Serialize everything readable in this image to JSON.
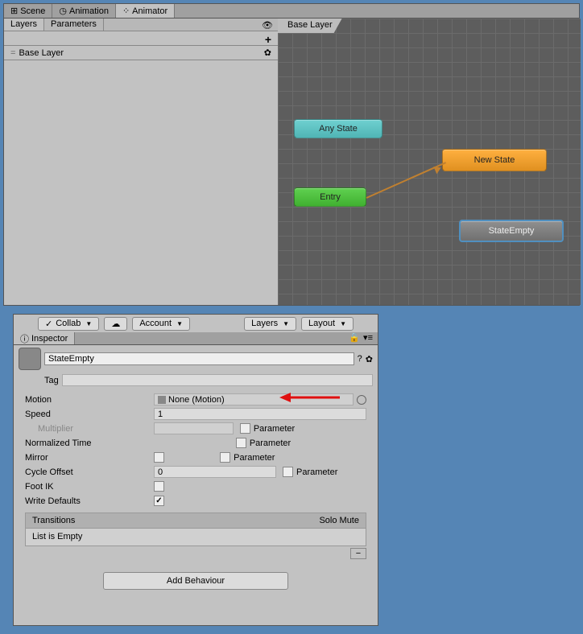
{
  "top": {
    "tabs": [
      {
        "label": "Scene",
        "icon": "grid-icon"
      },
      {
        "label": "Animation",
        "icon": "clock-icon"
      },
      {
        "label": "Animator",
        "icon": "animator-icon"
      }
    ],
    "subTabs": [
      "Layers",
      "Parameters"
    ],
    "breadcrumb": "Base Layer",
    "layers": [
      {
        "name": "Base Layer"
      }
    ],
    "nodes": {
      "anyState": "Any State",
      "newState": "New State",
      "entry": "Entry",
      "stateEmpty": "StateEmpty"
    }
  },
  "toolbar": {
    "collab": "Collab",
    "account": "Account",
    "layers": "Layers",
    "layout": "Layout"
  },
  "inspector": {
    "title": "Inspector",
    "name": "StateEmpty",
    "tagLabel": "Tag",
    "tag": "",
    "props": {
      "motion": {
        "label": "Motion",
        "value": "None (Motion)"
      },
      "speed": {
        "label": "Speed",
        "value": "1"
      },
      "multiplier": {
        "label": "Multiplier",
        "value": "",
        "param": "Parameter"
      },
      "normalizedTime": {
        "label": "Normalized Time",
        "param": "Parameter"
      },
      "mirror": {
        "label": "Mirror",
        "checked": false,
        "param": "Parameter"
      },
      "cycleOffset": {
        "label": "Cycle Offset",
        "value": "0",
        "param": "Parameter"
      },
      "footIK": {
        "label": "Foot IK",
        "checked": false
      },
      "writeDefaults": {
        "label": "Write Defaults",
        "checked": true
      }
    },
    "transitions": {
      "header": "Transitions",
      "solo": "Solo",
      "mute": "Mute",
      "empty": "List is Empty"
    },
    "addBehaviour": "Add Behaviour"
  }
}
